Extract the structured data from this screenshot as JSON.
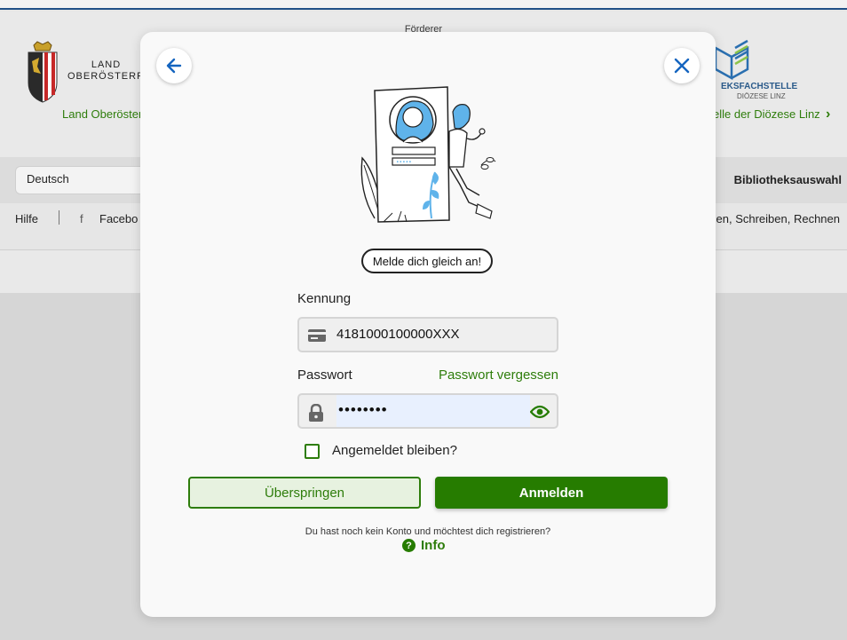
{
  "background": {
    "sponsor_heading": "Förderer",
    "land_line1": "LAND",
    "land_line2": "OBERÖSTERR",
    "land_link": "Land Oberöster",
    "fach_logo_text": "EKSFACHSTELLE",
    "fach_logo_sub": "DIÖZESE LINZ",
    "fach_link": "elle der Diözese Linz",
    "language_select": "Deutsch",
    "library_select": "Bibliotheksauswahl",
    "subnav_help": "Hilfe",
    "subnav_facebook": "Facebo",
    "subnav_right": "sen, Schreiben, Rechnen"
  },
  "modal": {
    "prompt_pill": "Melde dich gleich an!",
    "kennung_label": "Kennung",
    "kennung_value": "4181000100000XXX",
    "passwort_label": "Passwort",
    "forgot_link": "Passwort vergessen",
    "password_masked": "••••••••",
    "remember_label": "Angemeldet bleiben?",
    "remember_checked": false,
    "skip_button": "Überspringen",
    "login_button": "Anmelden",
    "register_text": "Du hast noch kein Konto und möchtest dich registrieren?",
    "info_link": "Info"
  },
  "colors": {
    "accent_green": "#267c00",
    "link_green": "#2e7d0b",
    "icon_blue": "#1565c0",
    "illustration_blue": "#5fb3ea"
  },
  "icons": [
    "back-arrow-icon",
    "close-icon",
    "card-icon",
    "lock-icon",
    "eye-icon",
    "info-icon",
    "chevron-right-icon",
    "facebook-icon"
  ]
}
